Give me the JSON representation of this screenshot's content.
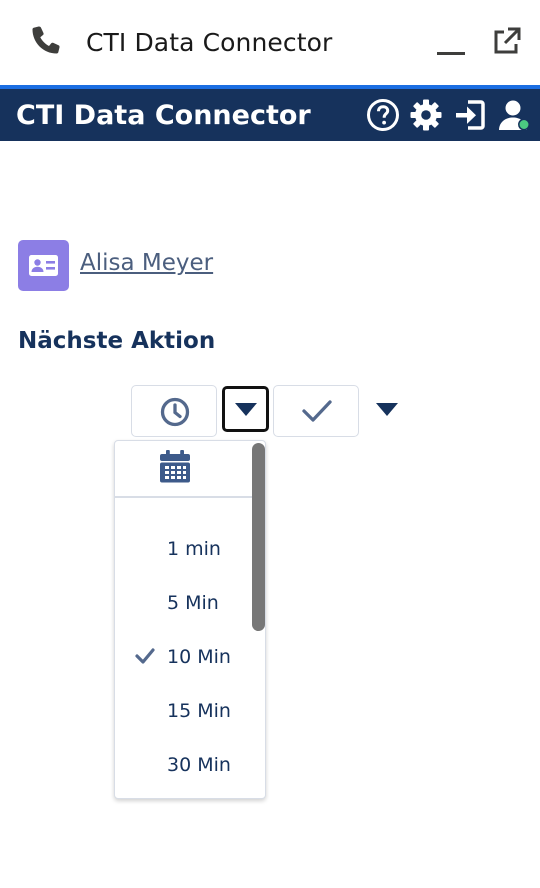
{
  "utility_bar": {
    "title": "CTI Data Connector",
    "icons": [
      "phone-icon",
      "minimize-icon",
      "popout-icon"
    ]
  },
  "header": {
    "title": "CTI Data Connector",
    "bg_color": "#16325c",
    "accent_color": "#1b6ee2",
    "icons": [
      "help-icon",
      "settings-icon",
      "login-icon",
      "user-status-icon"
    ],
    "status_color": "#4bca81"
  },
  "contact": {
    "name": "Alisa Meyer",
    "avatar_icon": "contact-card-icon",
    "avatar_color": "#8c7ee5"
  },
  "next_action": {
    "title": "Nächste Aktion",
    "buttons": [
      "clock-icon",
      "chevron-down-icon",
      "check-icon",
      "chevron-down-icon"
    ]
  },
  "dropdown": {
    "header_icon": "calendar-icon",
    "items": [
      {
        "label": "1 min",
        "selected": false
      },
      {
        "label": "5 Min",
        "selected": false
      },
      {
        "label": "10 Min",
        "selected": true
      },
      {
        "label": "15 Min",
        "selected": false
      },
      {
        "label": "30 Min",
        "selected": false
      }
    ]
  }
}
